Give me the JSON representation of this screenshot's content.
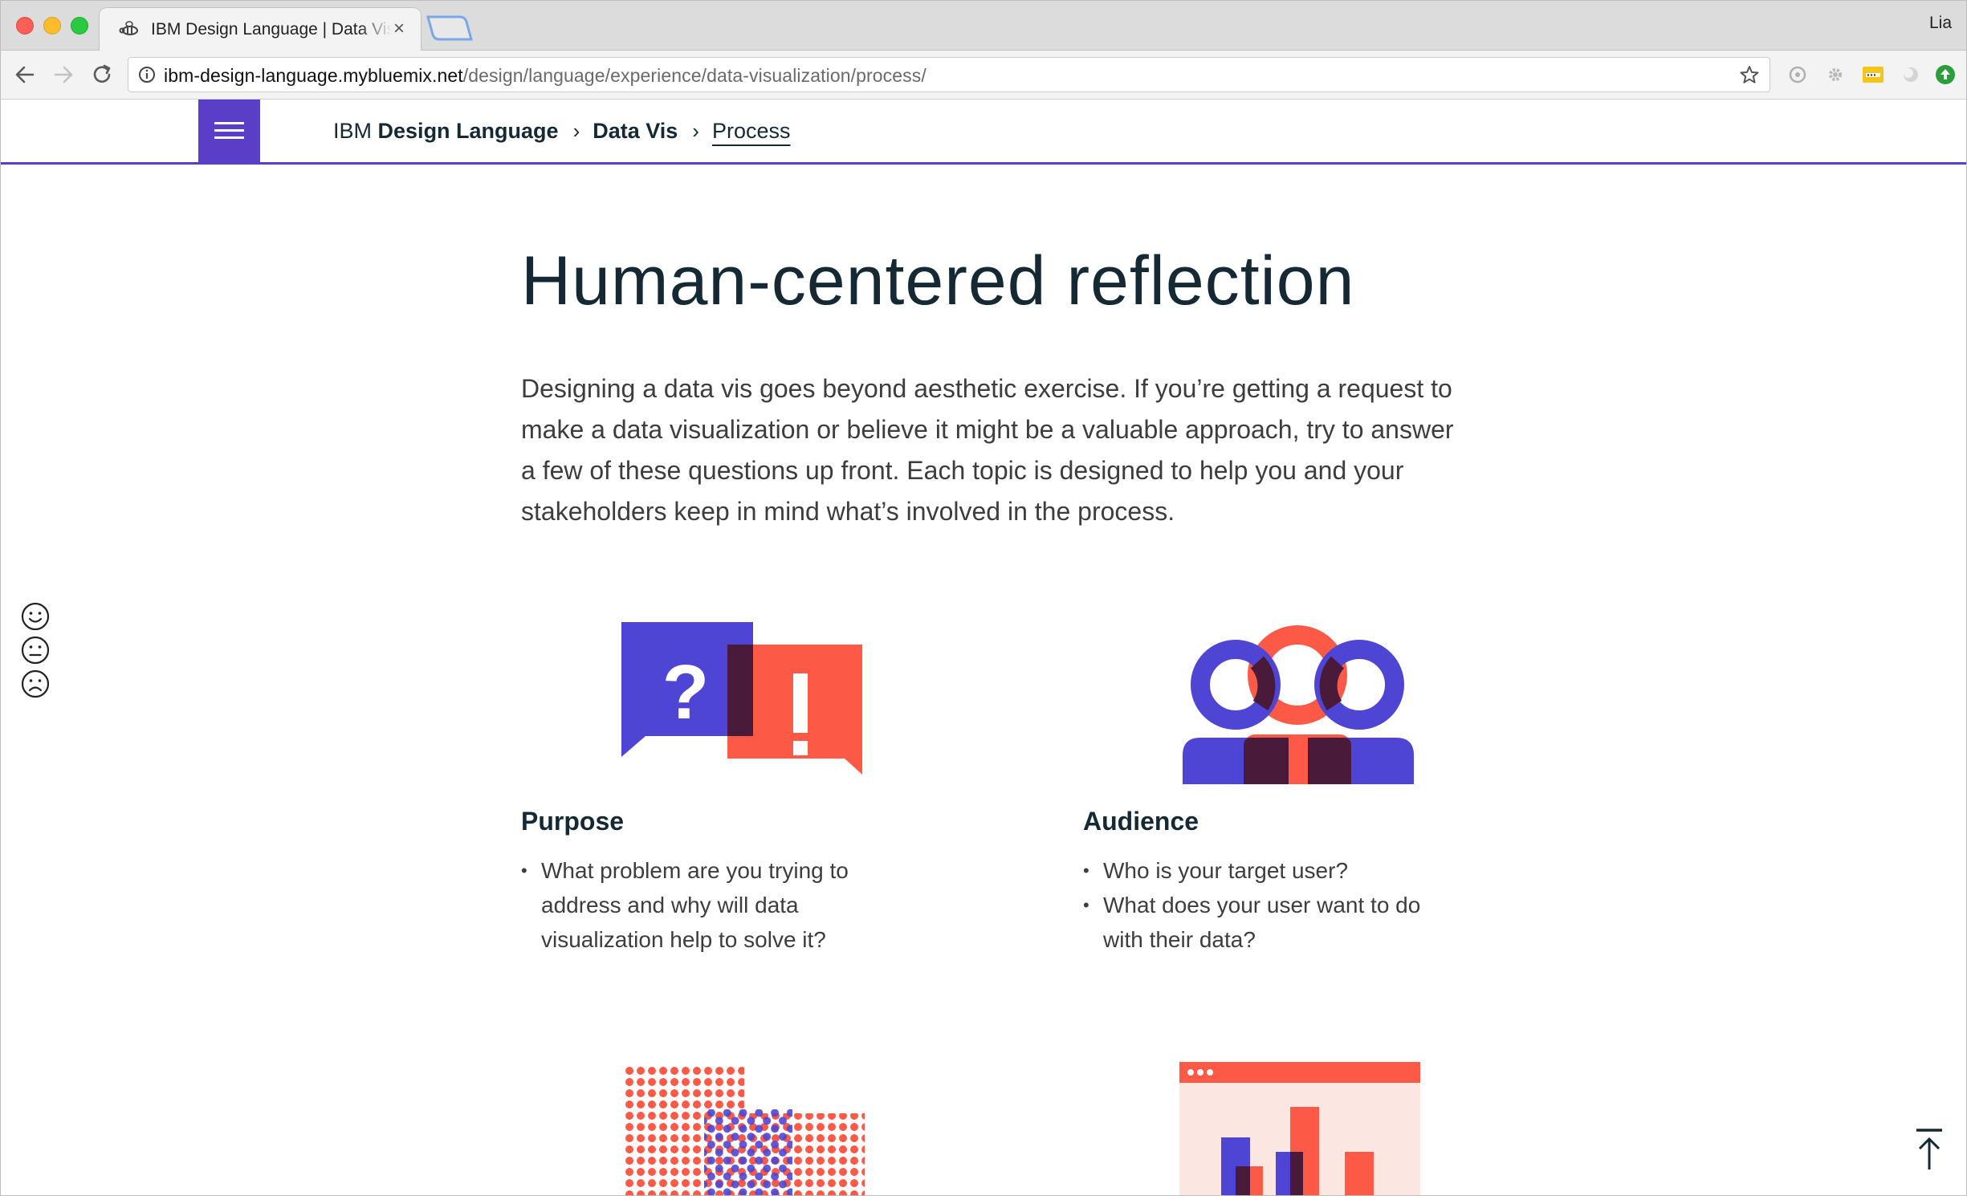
{
  "browser": {
    "tab_title": "IBM Design Language | Data Vis",
    "tab_close": "×",
    "profile": "Lia",
    "url_host": "ibm-design-language.mybluemix.net",
    "url_path": "/design/language/experience/data-visualization/process/"
  },
  "header": {
    "brand_prefix": "IBM",
    "brand_name": "Design Language",
    "crumb_separator": "›",
    "crumb_section": "Data Vis",
    "crumb_current": "Process"
  },
  "main": {
    "title": "Human-centered reflection",
    "intro": "Designing a data vis goes beyond aesthetic exercise. If you’re getting a request to make a data visualization or believe it might be a valuable approach, try to answer a few of these questions up front. Each topic is designed to help you and your stakeholders keep in mind what’s involved in the process.",
    "topics": [
      {
        "title": "Purpose",
        "icon": "question-exclamation-speech-bubbles-icon",
        "questions": [
          "What problem are you trying to address and why will data visualization help to solve it?"
        ]
      },
      {
        "title": "Audience",
        "icon": "audience-people-icon",
        "questions": [
          "Who is your target user?",
          "What does your user want to do with their data?"
        ]
      }
    ]
  },
  "colors": {
    "accent": "#5a3ec8",
    "indigo": "#4e45d4",
    "coral": "#fc5a47",
    "dark_overlap": "#4a1a3a",
    "text": "#152935"
  },
  "feedback": [
    "smile-face-icon",
    "neutral-face-icon",
    "frown-face-icon"
  ],
  "back_to_top": "arrow-up-icon"
}
